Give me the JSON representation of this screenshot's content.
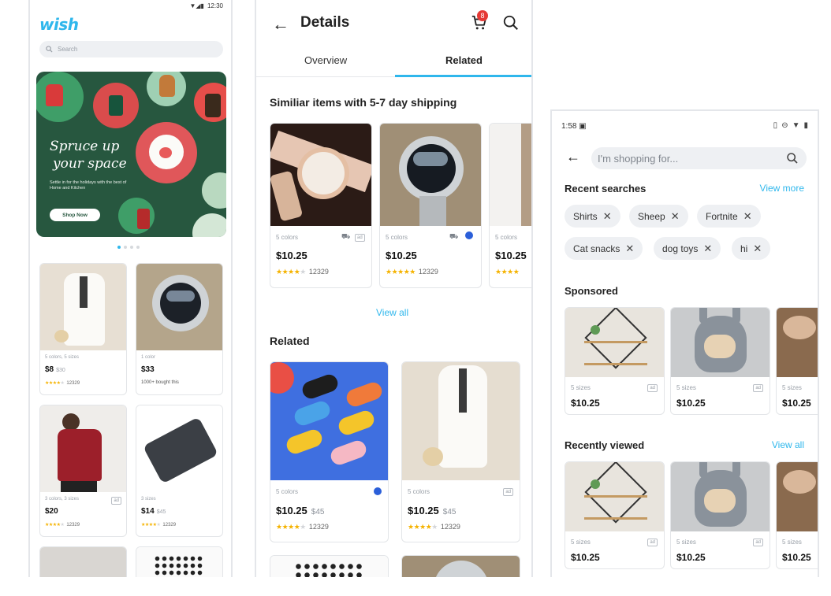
{
  "phone1": {
    "status_time": "12:30",
    "logo": "wish",
    "search_placeholder": "Search",
    "banner": {
      "title_line1": "Spruce up",
      "title_line2": "your space",
      "subtitle": "Settle in for the holidays with the best of Home and Kitchen",
      "button": "Shop Now"
    },
    "products": [
      {
        "meta": "5 colors, 5 sizes",
        "price": "$8",
        "old_price": "$30",
        "stars": 4,
        "reviews": "12329"
      },
      {
        "meta": "1 color",
        "price": "$33",
        "old_price": "",
        "extra": "1000+ bought this"
      },
      {
        "meta": "3 colors, 3 sizes",
        "price": "$20",
        "old_price": "",
        "stars": 4,
        "reviews": "12329",
        "ad": "ad"
      },
      {
        "meta": "3 sizes",
        "price": "$14",
        "old_price": "$45",
        "stars": 4,
        "reviews": "12329"
      }
    ]
  },
  "phone2": {
    "title": "Details",
    "cart_count": "8",
    "tabs": [
      "Overview",
      "Related"
    ],
    "section_similar": "Similiar items with 5-7 day shipping",
    "similar": [
      {
        "meta": "5 colors",
        "price": "$10.25",
        "reviews": "12329",
        "ad": "ad"
      },
      {
        "meta": "5 colors",
        "price": "$10.25",
        "reviews": "12329"
      },
      {
        "meta": "5 colors",
        "price": "$10.25"
      }
    ],
    "view_all": "View all",
    "section_related": "Related",
    "related": [
      {
        "meta": "5 colors",
        "price": "$10.25",
        "old_price": "$45",
        "reviews": "12329"
      },
      {
        "meta": "5 colors",
        "price": "$10.25",
        "old_price": "$45",
        "reviews": "12329",
        "ad": "ad"
      }
    ]
  },
  "phone3": {
    "status_time": "1:58",
    "search_placeholder": "I'm shopping for...",
    "recent_title": "Recent searches",
    "view_more": "View more",
    "chips": [
      "Shirts",
      "Sheep",
      "Fortnite",
      "Cat snacks",
      "dog toys",
      "hi"
    ],
    "sponsored_title": "Sponsored",
    "recently_viewed_title": "Recently viewed",
    "view_all": "View all",
    "sponsored": [
      {
        "meta": "5 sizes",
        "price": "$10.25",
        "ad": "ad"
      },
      {
        "meta": "5 sizes",
        "price": "$10.25",
        "ad": "ad"
      },
      {
        "meta": "5 sizes",
        "price": "$10.25"
      }
    ],
    "recent": [
      {
        "meta": "5 sizes",
        "price": "$10.25",
        "ad": "ad"
      },
      {
        "meta": "5 sizes",
        "price": "$10.25",
        "ad": "ad"
      },
      {
        "meta": "5 sizes",
        "price": "$10.25"
      }
    ]
  },
  "colors": {
    "accent": "#2fb7ec",
    "banner_green": "#27573f",
    "badge_red": "#e53935",
    "star": "#f5b301"
  }
}
